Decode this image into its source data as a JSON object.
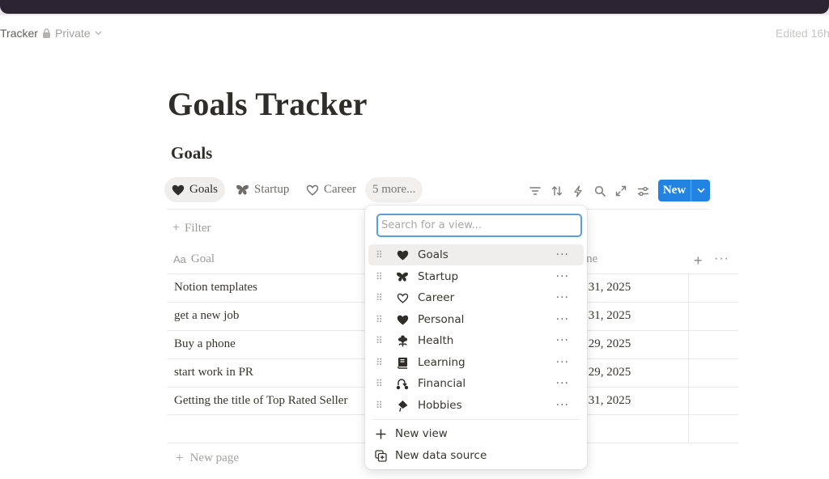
{
  "header": {
    "breadcrumb": "Tracker",
    "privacy": "Private",
    "edited": "Edited 16h"
  },
  "page": {
    "title": "Goals Tracker"
  },
  "database": {
    "title": "Goals",
    "tabs": [
      {
        "icon": "heart-filled-icon",
        "label": "Goals"
      },
      {
        "icon": "butterfly-icon",
        "label": "Startup"
      },
      {
        "icon": "heart-outline-icon",
        "label": "Career"
      }
    ],
    "more_tabs": "5 more...",
    "new_button": "New",
    "filter": "Filter",
    "columns": {
      "goal": "Goal",
      "deadline": "ine"
    },
    "rows": [
      {
        "goal": "Notion templates",
        "date": "r 31, 2025"
      },
      {
        "goal": "get a new job",
        "date": "r 31, 2025"
      },
      {
        "goal": "Buy a phone",
        "date": "r 29, 2025"
      },
      {
        "goal": "start work in PR",
        "date": "r 29, 2025"
      },
      {
        "goal": "Getting the title of Top Rated Seller",
        "date": "r 31, 2025"
      }
    ],
    "new_page": "New page"
  },
  "view_menu": {
    "search_placeholder": "Search for a view...",
    "items": [
      {
        "icon": "heart-filled-icon",
        "label": "Goals"
      },
      {
        "icon": "butterfly-icon",
        "label": "Startup"
      },
      {
        "icon": "heart-outline-icon",
        "label": "Career"
      },
      {
        "icon": "heart-filled-icon",
        "label": "Personal"
      },
      {
        "icon": "flower-icon",
        "label": "Health"
      },
      {
        "icon": "book-icon",
        "label": "Learning"
      },
      {
        "icon": "route-icon",
        "label": "Financial"
      },
      {
        "icon": "kite-icon",
        "label": "Hobbies"
      }
    ],
    "new_view": "New view",
    "new_data_source": "New data source"
  },
  "colors": {
    "accent": "#2383e2",
    "selected_bg": "#efeeec",
    "focus_ring": "#5a9fd8"
  }
}
